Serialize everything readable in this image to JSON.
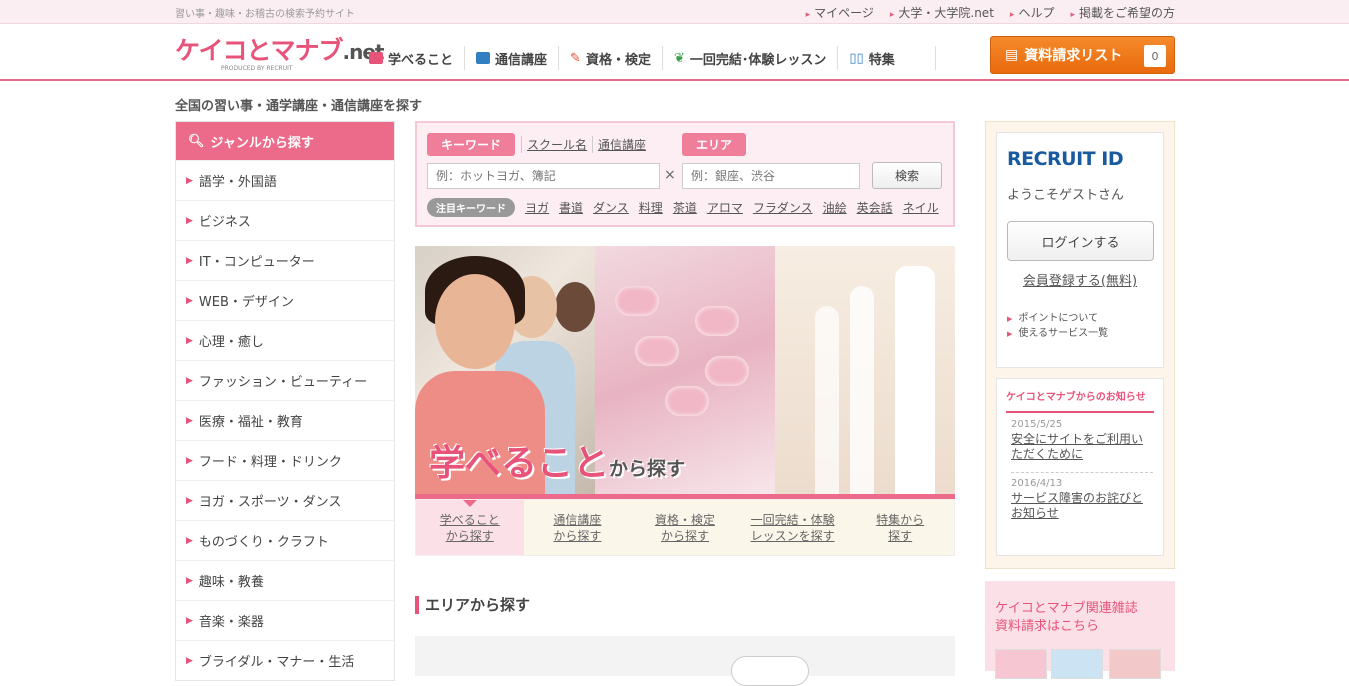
{
  "topbar": {
    "tagline": "習い事・趣味・お稽古の検索予約サイト",
    "links": [
      "マイページ",
      "大学・大学院.net",
      "ヘルプ",
      "掲載をご希望の方"
    ]
  },
  "header": {
    "logo_main": "ケイコとマナブ",
    "logo_net": ".net",
    "logo_sub": "PRODUCED BY RECRUIT",
    "nav": [
      {
        "label": "学べること",
        "icon": "bag-icon"
      },
      {
        "label": "通信講座",
        "icon": "mail-icon"
      },
      {
        "label": "資格・検定",
        "icon": "pen-icon"
      },
      {
        "label": "一回完結･体験レッスン",
        "icon": "leaf-icon"
      },
      {
        "label": "特集",
        "icon": "book-icon"
      }
    ],
    "request_button": "資料請求リスト",
    "request_count": "0"
  },
  "page_title": "全国の習い事・通学講座・通信講座を探す",
  "sidebar": {
    "heading": "ジャンルから探す",
    "items": [
      "語学・外国語",
      "ビジネス",
      "IT・コンピューター",
      "WEB・デザイン",
      "心理・癒し",
      "ファッション・ビューティー",
      "医療・福祉・教育",
      "フード・料理・ドリンク",
      "ヨガ・スポーツ・ダンス",
      "ものづくり・クラフト",
      "趣味・教養",
      "音楽・楽器",
      "ブライダル・マナー・生活"
    ]
  },
  "search": {
    "keyword_tab": "キーワード",
    "school_link": "スクール名",
    "course_link": "通信講座",
    "area_tab": "エリア",
    "keyword_placeholder": "例：ホットヨガ、簿記",
    "area_placeholder": "例：銀座、渋谷",
    "clear": "×",
    "button": "検索",
    "hot_label": "注目キーワード",
    "hot_keywords": [
      "ヨガ",
      "書道",
      "ダンス",
      "料理",
      "茶道",
      "アロマ",
      "フラダンス",
      "油絵",
      "英会話",
      "ネイル"
    ]
  },
  "hero": {
    "big": "学べること",
    "small": "から探す"
  },
  "hero_tabs": [
    {
      "l1": "学べること",
      "l2": "から探す"
    },
    {
      "l1": "通信講座",
      "l2": "から探す"
    },
    {
      "l1": "資格・検定",
      "l2": "から探す"
    },
    {
      "l1": "一回完結・体験",
      "l2": "レッスンを探す"
    },
    {
      "l1": "特集から",
      "l2": "探す"
    }
  ],
  "area_heading": "エリアから探す",
  "recruit": {
    "logo_a": "RECRUIT",
    "logo_b": " ID",
    "welcome": "ようこそゲストさん",
    "login": "ログインする",
    "register": "会員登録する(無料)",
    "links": [
      "ポイントについて",
      "使えるサービス一覧"
    ]
  },
  "news": {
    "heading": "ケイコとマナブからのお知らせ",
    "items": [
      {
        "date": "2015/5/25",
        "title": "安全にサイトをご利用いただくために"
      },
      {
        "date": "2016/4/13",
        "title": "サービス障害のお詫びとお知らせ"
      }
    ]
  },
  "magazine": {
    "line1": "ケイコとマナブ関連雑誌",
    "line2": "資料請求はこちら"
  },
  "colors": {
    "accent_pink": "#e8537a",
    "orange_button": "#f07c1b",
    "recruit_blue": "#1a5a9e"
  }
}
